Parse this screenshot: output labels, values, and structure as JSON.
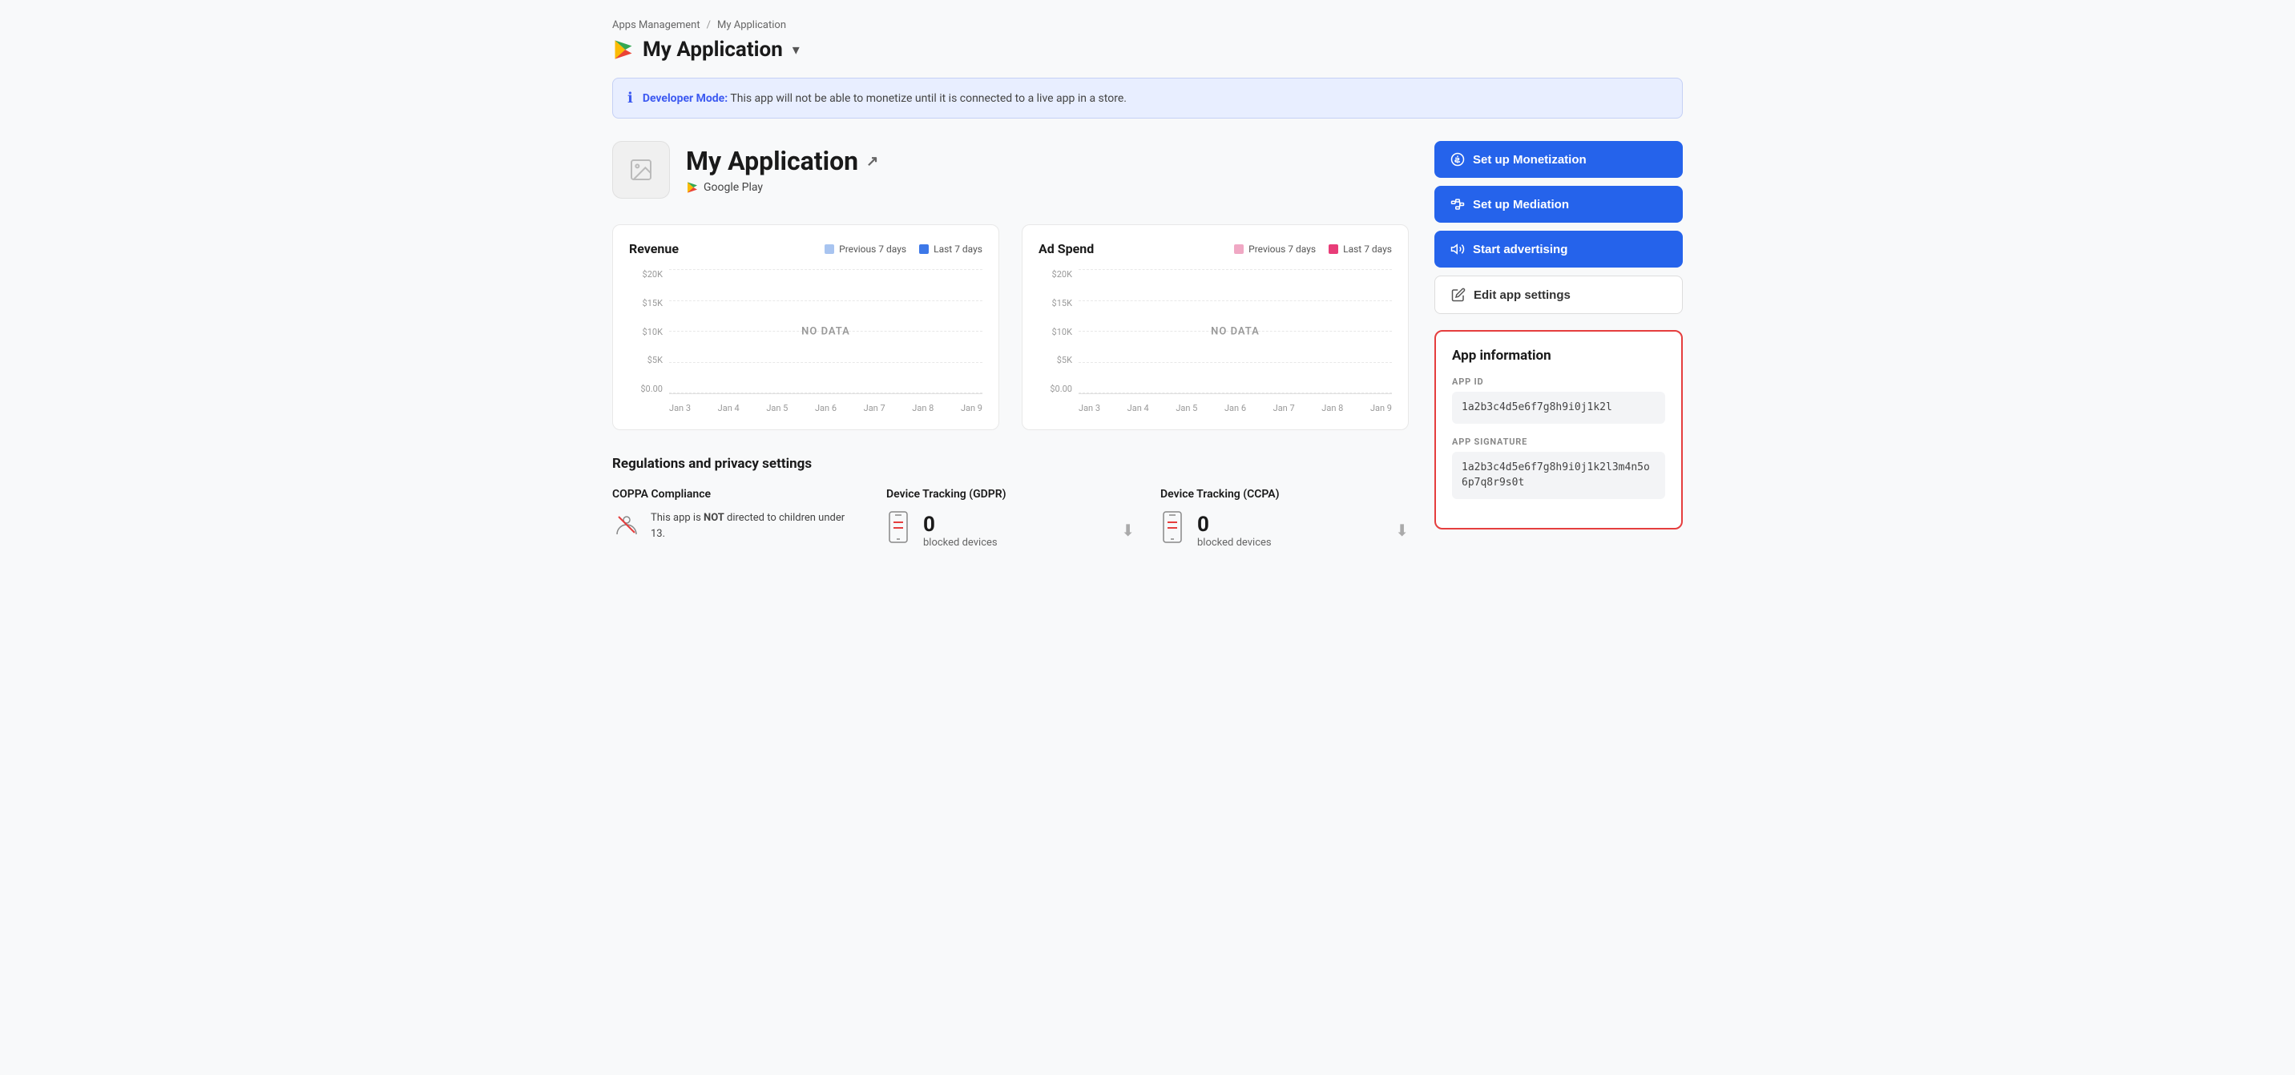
{
  "breadcrumb": {
    "parent": "Apps Management",
    "current": "My Application",
    "separator": "/"
  },
  "app_header": {
    "title": "My Application",
    "chevron": "▾"
  },
  "dev_banner": {
    "label": "Developer Mode:",
    "message": "This app will not be able to monetize until it is connected to a live app in a store."
  },
  "app_card": {
    "name": "My Application",
    "store": "Google Play",
    "external_link": "↗"
  },
  "revenue_chart": {
    "title": "Revenue",
    "legend_prev": "Previous 7 days",
    "legend_last": "Last 7 days",
    "prev_color": "#a8c4f0",
    "last_color": "#3d78e8",
    "no_data": "NO DATA",
    "y_labels": [
      "$20K",
      "$15K",
      "$10K",
      "$5K",
      "$0.00"
    ],
    "x_labels": [
      "Jan 3",
      "Jan 4",
      "Jan 5",
      "Jan 6",
      "Jan 7",
      "Jan 8",
      "Jan 9"
    ]
  },
  "adspend_chart": {
    "title": "Ad Spend",
    "legend_prev": "Previous 7 days",
    "legend_last": "Last 7 days",
    "prev_color": "#f0a8c4",
    "last_color": "#e83d78",
    "no_data": "NO DATA",
    "y_labels": [
      "$20K",
      "$15K",
      "$10K",
      "$5K",
      "$0.00"
    ],
    "x_labels": [
      "Jan 3",
      "Jan 4",
      "Jan 5",
      "Jan 6",
      "Jan 7",
      "Jan 8",
      "Jan 9"
    ]
  },
  "regulations": {
    "section_title": "Regulations and privacy settings",
    "coppa": {
      "title": "COPPA Compliance",
      "text_1": "This app is ",
      "bold": "NOT",
      "text_2": " directed to children under 13."
    },
    "gdpr": {
      "title": "Device Tracking (GDPR)",
      "count": "0",
      "label": "blocked devices"
    },
    "ccpa": {
      "title": "Device Tracking (CCPA)",
      "count": "0",
      "label": "blocked devices"
    }
  },
  "sidebar": {
    "btn_monetization": "Set up Monetization",
    "btn_mediation": "Set up Mediation",
    "btn_advertising": "Start advertising",
    "btn_edit": "Edit app settings"
  },
  "app_information": {
    "title": "App information",
    "app_id_label": "APP ID",
    "app_id_value": "1a2b3c4d5e6f7g8h9i0j1k2l",
    "app_sig_label": "APP SIGNATURE",
    "app_sig_value": "1a2b3c4d5e6f7g8h9i0j1k2l3m4n5o6p7q8r9s0t"
  }
}
